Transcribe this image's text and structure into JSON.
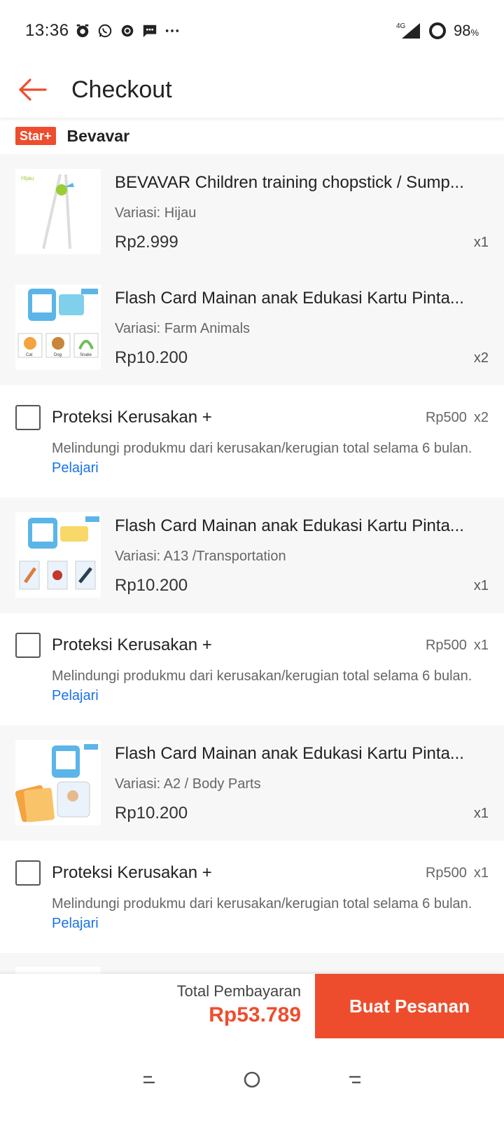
{
  "status_bar": {
    "time": "13:36",
    "network": "4G",
    "battery": "98",
    "battery_unit": "%"
  },
  "header": {
    "title": "Checkout"
  },
  "shop": {
    "badge": "Star+",
    "name": "Bevavar"
  },
  "items": [
    {
      "name": "BEVAVAR Children training chopstick / Sump...",
      "variation": "Variasi: Hijau",
      "price": "Rp2.999",
      "qty": "x1",
      "thumb_label": "Hijau"
    },
    {
      "name": "Flash Card Mainan anak Edukasi Kartu Pinta...",
      "variation": "Variasi: Farm Animals",
      "price": "Rp10.200",
      "qty": "x2",
      "thumb_labels": [
        "Cat",
        "Dog",
        "Snake"
      ]
    },
    {
      "name": "Flash Card Mainan anak Edukasi Kartu Pinta...",
      "variation": "Variasi: A13 /Transportation",
      "price": "Rp10.200",
      "qty": "x1"
    },
    {
      "name": "Flash Card Mainan anak Edukasi Kartu Pinta...",
      "variation": "Variasi: A2 / Body Parts",
      "price": "Rp10.200",
      "qty": "x1"
    }
  ],
  "protection": [
    {
      "title": "Proteksi Kerusakan +",
      "price": "Rp500",
      "qty": "x2",
      "desc": "Melindungi produkmu dari kerusakan/kerugian total selama 6 bulan.",
      "link": "Pelajari"
    },
    {
      "title": "Proteksi Kerusakan +",
      "price": "Rp500",
      "qty": "x1",
      "desc": "Melindungi produkmu dari kerusakan/kerugian total selama 6 bulan.",
      "link": "Pelajari"
    },
    {
      "title": "Proteksi Kerusakan +",
      "price": "Rp500",
      "qty": "x1",
      "desc": "Melindungi produkmu dari kerusakan/kerugian total selama 6 bulan.",
      "link": "Pelajari"
    }
  ],
  "footer": {
    "total_label": "Total Pembayaran",
    "total_value": "Rp53.789",
    "order_button": "Buat Pesanan"
  },
  "colors": {
    "accent": "#ee4d2d",
    "link": "#1a73e8"
  }
}
